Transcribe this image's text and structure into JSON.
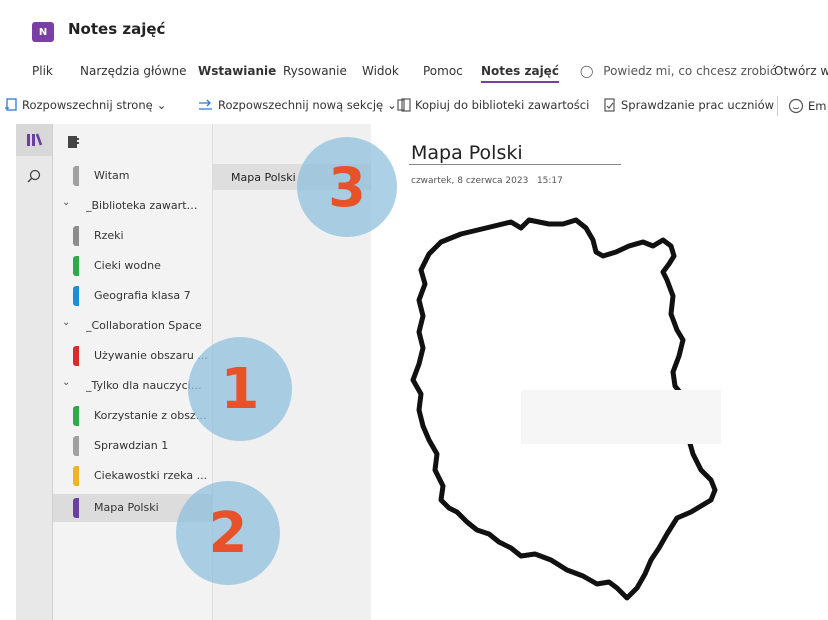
{
  "app": {
    "title": "Notes zajęć",
    "icon_text": "N"
  },
  "ribbon": {
    "tabs": [
      "Plik",
      "Narzędzia główne",
      "Wstawianie",
      "Rysowanie",
      "Widok",
      "Pomoc",
      "Notes zajęć"
    ],
    "tell_me": "Powiedz mi, co chcesz zrobić",
    "open_in": "Otwórz w"
  },
  "toolbar": {
    "distribute_page": "Rozpowszechnij stronę",
    "distribute_section": "Rozpowszechnij nową sekcję",
    "copy_library": "Kopiuj do biblioteki zawartości",
    "review": "Sprawdzanie prac uczniów",
    "em": "Em"
  },
  "sections": {
    "items": [
      {
        "label": "Witam",
        "color": "#a0a0a0"
      },
      {
        "label": "_Biblioteka zawartości",
        "group": true
      },
      {
        "label": "Rzeki",
        "color": "#8c8c8c"
      },
      {
        "label": "Cieki wodne",
        "color": "#2eaa4a"
      },
      {
        "label": "Geografia klasa 7",
        "color": "#1a8fd6"
      },
      {
        "label": "_Collaboration Space",
        "group": true
      },
      {
        "label": "Używanie obszaru ...",
        "color": "#d92b2b"
      },
      {
        "label": "_Tylko dla nauczyciela",
        "group": true
      },
      {
        "label": "Korzystanie z obsza...",
        "color": "#2eaa4a"
      },
      {
        "label": "Sprawdzian 1",
        "color": "#a0a0a0"
      },
      {
        "label": "Ciekawostki rzeka ...",
        "color": "#f0b429"
      },
      {
        "label": "Mapa Polski",
        "color": "#6a3fa0",
        "selected": true
      }
    ]
  },
  "pages": {
    "items": [
      {
        "label": "Mapa Polski"
      }
    ]
  },
  "page": {
    "title": "Mapa Polski",
    "date": "czwartek, 8 czerwca 2023",
    "time": "15:17"
  },
  "callouts": {
    "one": "1",
    "two": "2",
    "three": "3"
  },
  "colors": {
    "accent": "#7a3ea6",
    "callout_fill": "#8cbedc",
    "callout_text": "#e8522a"
  }
}
